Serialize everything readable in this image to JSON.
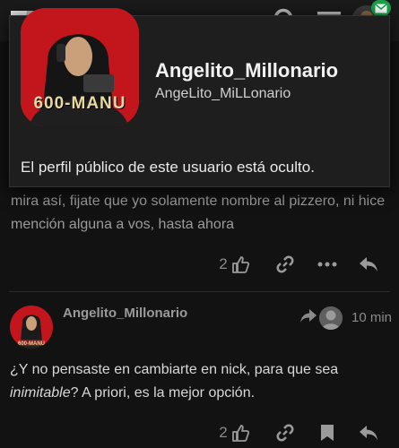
{
  "header": {
    "logo_icon": "site-logo",
    "search_icon": "search-icon",
    "menu_icon": "hamburger-menu-icon",
    "notification_icon": "envelope-icon"
  },
  "post1": {
    "text": "mira así, fijate que yo solamente nombre al pizzero, ni hice mención alguna a vos, hasta ahora",
    "likes": "2"
  },
  "post2": {
    "author": "Angelito_Millonario",
    "time": "10 min",
    "text_before": "¿Y no pensaste en cambiarte en nick, para que sea ",
    "text_em": "inimitable",
    "text_after": "? A priori, es la mejor opción.",
    "likes": "2"
  },
  "user_card": {
    "display_name": "Angelito_Millonario",
    "username": "AngeLito_MiLLonario",
    "avatar_caption": "600-MANU",
    "hidden_message": "El perfil público de este usuario está oculto."
  },
  "colors": {
    "background": "#121212",
    "card": "#1e1e1e",
    "avatar_red": "#c2161c",
    "badge_green": "#17a34a"
  }
}
